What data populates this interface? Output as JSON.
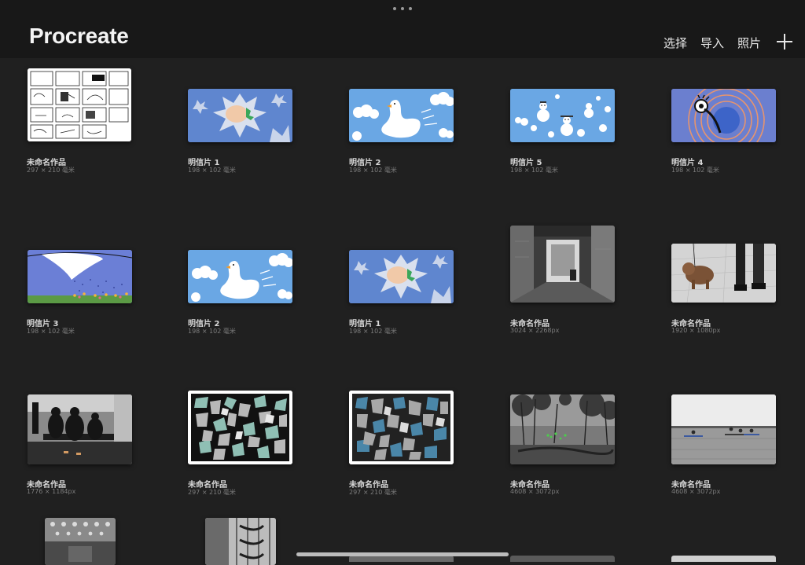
{
  "app": {
    "title": "Procreate"
  },
  "header": {
    "actions": [
      "选择",
      "导入",
      "照片"
    ],
    "add_icon": "plus-icon"
  },
  "gallery": {
    "items": [
      {
        "title": "未命名作品",
        "size": "297 × 210 毫米",
        "thumb": "storyboard-sketch"
      },
      {
        "title": "明信片 1",
        "size": "198 × 102 毫米",
        "thumb": "starburst-hand"
      },
      {
        "title": "明信片 2",
        "size": "198 × 102 毫米",
        "thumb": "swan"
      },
      {
        "title": "明信片 5",
        "size": "198 × 102 毫米",
        "thumb": "snowmen"
      },
      {
        "title": "明信片 4",
        "size": "198 × 102 毫米",
        "thumb": "eye-circles"
      },
      {
        "title": "明信片 3",
        "size": "198 × 102 毫米",
        "thumb": "flag-field"
      },
      {
        "title": "明信片 2",
        "size": "198 × 102 毫米",
        "thumb": "swan"
      },
      {
        "title": "明信片 1",
        "size": "198 × 102 毫米",
        "thumb": "starburst-hand"
      },
      {
        "title": "未命名作品",
        "size": "3024 × 2268px",
        "thumb": "bw-corridor"
      },
      {
        "title": "未命名作品",
        "size": "1920 × 1080px",
        "thumb": "dog-photo"
      },
      {
        "title": "未命名作品",
        "size": "1776 × 1184px",
        "thumb": "bw-people-bench"
      },
      {
        "title": "未命名作品",
        "size": "297 × 210 毫米",
        "thumb": "paper-collage-light"
      },
      {
        "title": "未命名作品",
        "size": "297 × 210 毫米",
        "thumb": "paper-collage-blue"
      },
      {
        "title": "未命名作品",
        "size": "4608 × 3072px",
        "thumb": "bw-forest-green"
      },
      {
        "title": "未命名作品",
        "size": "4608 × 3072px",
        "thumb": "bw-sea-kayak"
      },
      {
        "title": "",
        "size": "",
        "thumb": "bw-mall"
      },
      {
        "title": "",
        "size": "",
        "thumb": "bw-stairs"
      }
    ]
  }
}
